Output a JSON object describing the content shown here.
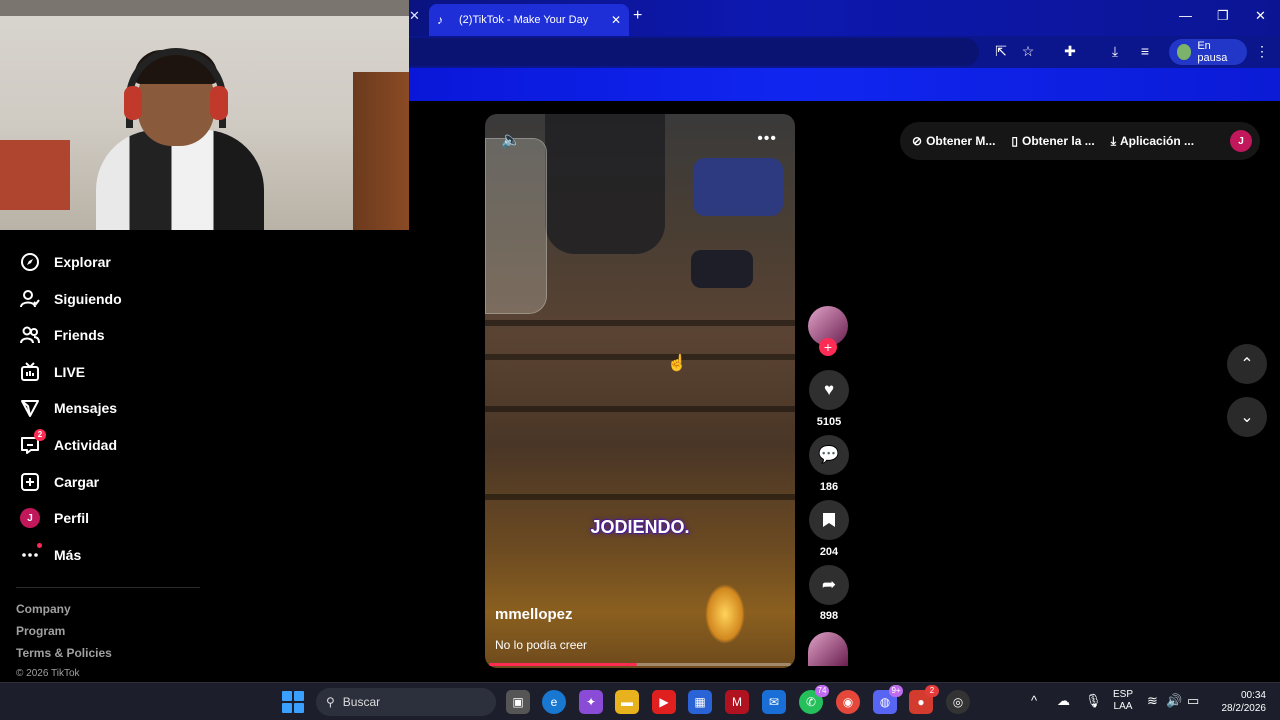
{
  "browser": {
    "tab_title": "(2)TikTok - Make Your Day",
    "profile_status": "En pausa"
  },
  "sidebar": {
    "items": [
      {
        "label": "Explorar",
        "icon": "compass-icon"
      },
      {
        "label": "Siguiendo",
        "icon": "user-follow-icon"
      },
      {
        "label": "Friends",
        "icon": "friends-icon"
      },
      {
        "label": "LIVE",
        "icon": "live-tv-icon"
      },
      {
        "label": "Mensajes",
        "icon": "paper-plane-icon"
      },
      {
        "label": "Actividad",
        "icon": "activity-icon",
        "badge": "2"
      },
      {
        "label": "Cargar",
        "icon": "upload-plus-icon"
      },
      {
        "label": "Perfil",
        "icon": "avatar",
        "avatar_letter": "J"
      },
      {
        "label": "Más",
        "icon": "more-dots-icon"
      }
    ],
    "footer": {
      "links": [
        "Company",
        "Program",
        "Terms & Policies"
      ],
      "copyright": "© 2026 TikTok"
    }
  },
  "video": {
    "caption": "JODIENDO.",
    "username": "mmellopez",
    "description": "No lo podía creer",
    "progress": 0.49
  },
  "actions": {
    "likes": "5105",
    "comments": "186",
    "saves": "204",
    "shares": "898"
  },
  "top_bar": {
    "get_coins": "Obtener M...",
    "get_app": "Obtener la ...",
    "desktop_app": "Aplicación ...",
    "user_letter": "J"
  },
  "taskbar": {
    "search_placeholder": "Buscar",
    "whatsapp_badge": "74",
    "discord_badge": "9+",
    "recording_badge": "2",
    "lang_line1": "ESP",
    "lang_line2": "LAA",
    "time": "00:34",
    "date": "28/2/2026"
  },
  "colors": {
    "accent": "#fe2c55",
    "browser_blue": "#0d18b0",
    "taskbar": "#1c1f2b"
  }
}
